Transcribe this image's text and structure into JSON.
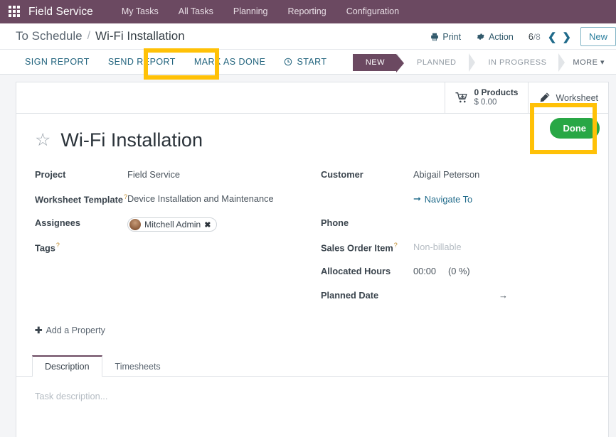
{
  "navbar": {
    "apps_icon": "apps-grid-icon",
    "brand": "Field Service",
    "menu": [
      {
        "label": "My Tasks"
      },
      {
        "label": "All Tasks"
      },
      {
        "label": "Planning"
      },
      {
        "label": "Reporting"
      },
      {
        "label": "Configuration"
      }
    ]
  },
  "breadcrumb": {
    "parent": "To Schedule",
    "separator": "/",
    "current": "Wi-Fi Installation"
  },
  "control_panel": {
    "print_label": "Print",
    "print_icon": "printer-icon",
    "action_label": "Action",
    "action_icon": "gear-icon",
    "pager_current": "6",
    "pager_separator": "/",
    "pager_total": "8",
    "prev_icon": "chevron-left-icon",
    "next_icon": "chevron-right-icon",
    "new_label": "New"
  },
  "action_buttons": [
    {
      "label": "SIGN REPORT",
      "icon": ""
    },
    {
      "label": "SEND REPORT",
      "icon": ""
    },
    {
      "label": "MARK AS DONE",
      "icon": "",
      "highlighted": true
    },
    {
      "label": "START",
      "icon": "clock-icon"
    }
  ],
  "statusbar": {
    "stages": [
      {
        "label": "NEW",
        "active": true
      },
      {
        "label": "PLANNED",
        "active": false
      },
      {
        "label": "IN PROGRESS",
        "active": false
      }
    ],
    "more_label": "MORE",
    "more_icon": "caret-down-icon"
  },
  "smart_buttons": {
    "products": {
      "icon": "cart-plus-icon",
      "count_label": "0 Products",
      "amount_label": "$ 0.00"
    },
    "worksheet": {
      "icon": "pencil-icon",
      "label": "Worksheet"
    }
  },
  "record": {
    "star_icon": "star-outline-icon",
    "title": "Wi-Fi Installation",
    "done_button": "Done",
    "done_highlighted": true
  },
  "form": {
    "left": [
      {
        "label": "Project",
        "help": false,
        "value": "Field Service",
        "type": "text"
      },
      {
        "label": "Worksheet Template",
        "help": true,
        "value": "Device Installation and Maintenance",
        "type": "text"
      },
      {
        "label": "Assignees",
        "help": false,
        "value": "Mitchell Admin",
        "type": "chip",
        "chip_remove_icon": "close-icon",
        "avatar_icon": "user-avatar"
      },
      {
        "label": "Tags",
        "help": true,
        "value": "",
        "type": "text"
      }
    ],
    "right": [
      {
        "label": "Customer",
        "help": false,
        "value": "Abigail Peterson",
        "type": "text"
      },
      {
        "label": "",
        "help": false,
        "value": "Navigate To",
        "type": "link",
        "icon": "arrow-right-icon"
      },
      {
        "label": "Phone",
        "help": false,
        "value": "",
        "type": "text"
      },
      {
        "label": "Sales Order Item",
        "help": true,
        "value": "Non-billable",
        "type": "muted"
      },
      {
        "label": "Allocated Hours",
        "help": false,
        "value": "00:00",
        "value2": "(0 %)",
        "type": "hours"
      },
      {
        "label": "Planned Date",
        "help": false,
        "value": "→",
        "type": "arrow"
      }
    ]
  },
  "add_property": {
    "plus": "✚",
    "label": "Add a Property"
  },
  "notebook": {
    "tabs": [
      {
        "label": "Description",
        "active": true
      },
      {
        "label": "Timesheets",
        "active": false
      }
    ],
    "description_placeholder": "Task description..."
  },
  "colors": {
    "navbar_bg": "#6b4961",
    "accent_teal": "#21637d",
    "highlight_yellow": "#ffc107",
    "done_green": "#28a745",
    "canvas_bg": "#f4f5f7"
  }
}
